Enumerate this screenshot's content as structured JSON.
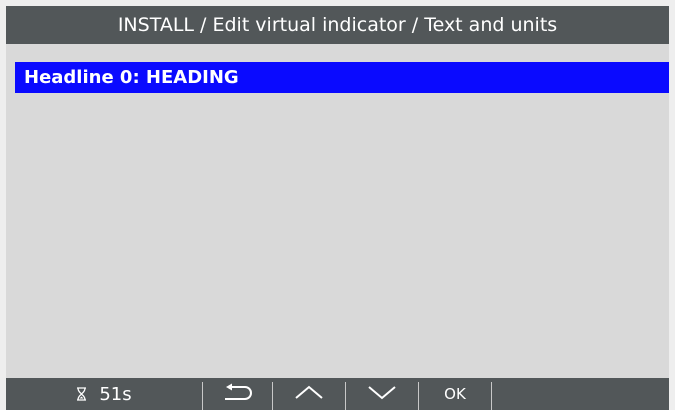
{
  "header": {
    "title": "INSTALL / Edit virtual indicator / Text and units"
  },
  "list": {
    "items": [
      {
        "label": "Headline 0: HEADING",
        "selected": true
      }
    ]
  },
  "footer": {
    "timer_icon": "hourglass-icon",
    "timer_value": "51s",
    "back_icon": "back-arrow-icon",
    "up_icon": "chevron-up-icon",
    "down_icon": "chevron-down-icon",
    "ok_label": "OK"
  },
  "colors": {
    "bar_background": "#525759",
    "screen_background": "#d9d9d9",
    "selection": "#0a0aff",
    "text_light": "#ffffff"
  }
}
